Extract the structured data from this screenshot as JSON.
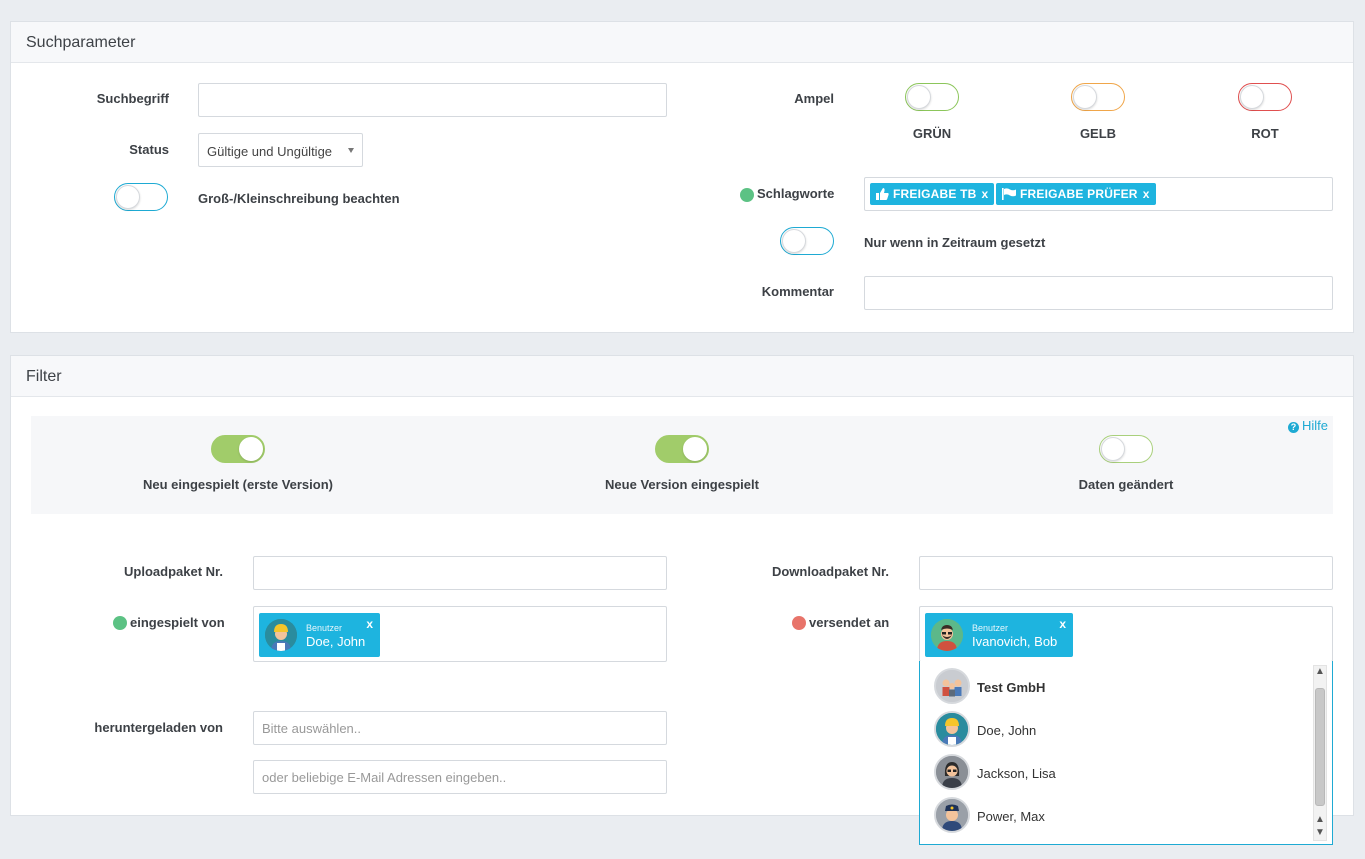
{
  "search": {
    "title": "Suchparameter",
    "suchbegriff_label": "Suchbegriff",
    "suchbegriff_value": "",
    "status_label": "Status",
    "status_value": "Gültige und Ungültige",
    "case_label": "Groß-/Kleinschreibung beachten",
    "case_on": false,
    "ampel_label": "Ampel",
    "ampel": [
      {
        "label": "GRÜN",
        "color": "#8cc65b",
        "on": false
      },
      {
        "label": "GELB",
        "color": "#f0a64a",
        "on": false
      },
      {
        "label": "ROT",
        "color": "#e04f4f",
        "on": false
      }
    ],
    "schlagworte_label": "Schlagworte",
    "schlagworte_dot_color": "#5cc284",
    "tags": [
      {
        "label": "FREIGABE TB",
        "icon": "thumbs-up-icon",
        "remove": "x"
      },
      {
        "label": "FREIGABE PRÜFER",
        "icon": "flag-icon",
        "remove": "x"
      }
    ],
    "zeitraum_label": "Nur wenn in Zeitraum gesetzt",
    "zeitraum_on": false,
    "kommentar_label": "Kommentar",
    "kommentar_value": ""
  },
  "filter": {
    "title": "Filter",
    "help": "Hilfe",
    "toggles": [
      {
        "label": "Neu eingespielt (erste Version)",
        "on": true
      },
      {
        "label": "Neue Version eingespielt",
        "on": true
      },
      {
        "label": "Daten geändert",
        "on": false
      }
    ],
    "upload_label": "Uploadpaket Nr.",
    "upload_value": "",
    "download_label": "Downloadpaket Nr.",
    "download_value": "",
    "eingespielt_label": "eingespielt von",
    "eingespielt_dot_color": "#5cc284",
    "eingespielt_user": {
      "role": "Benutzer",
      "name": "Doe, John",
      "remove": "x"
    },
    "versendet_label": "versendet an",
    "versendet_dot_color": "#e8746a",
    "versendet_user": {
      "role": "Benutzer",
      "name": "Ivanovich, Bob",
      "remove": "x"
    },
    "heruntergeladen_label": "heruntergeladen von",
    "heruntergeladen_placeholder": "Bitte auswählen..",
    "email_placeholder": "oder beliebige E-Mail Adressen eingeben..",
    "dropdown": [
      {
        "name": "Test GmbH",
        "bold": true,
        "icon": "group-avatar-icon"
      },
      {
        "name": "Doe, John",
        "bold": false,
        "icon": "worker-avatar-icon"
      },
      {
        "name": "Jackson, Lisa",
        "bold": false,
        "icon": "woman-avatar-icon"
      },
      {
        "name": "Power, Max",
        "bold": false,
        "icon": "police-avatar-icon"
      }
    ]
  }
}
